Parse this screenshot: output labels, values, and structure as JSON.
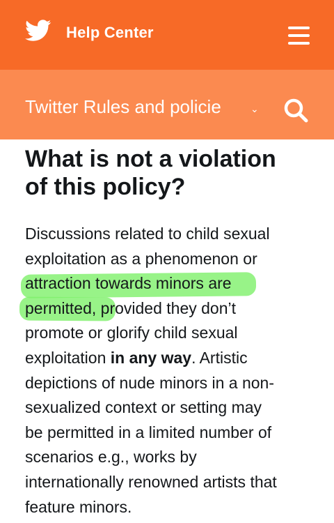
{
  "header": {
    "brand": "Help Center",
    "icons": {
      "logo": "twitter-bird-icon",
      "menu": "hamburger-menu-icon"
    },
    "color": "#f76a27"
  },
  "subnav": {
    "label": "Twitter Rules and policie",
    "chevron": "⌄",
    "icons": {
      "search": "search-icon"
    },
    "color": "#fb8a50"
  },
  "article": {
    "heading_line1": "What is not a violation",
    "heading_line2": "of this policy?",
    "lines": [
      "Discussions related to child sexual",
      "exploitation as a phenomenon or",
      "attraction towards minors are",
      "permitted, provided they don’t",
      "promote or glorify child sexual",
      "exploitation ",
      "in any way",
      ". Artistic",
      "depictions of nude minors in a non-",
      "sexualized context or setting may",
      "be permitted in a limited number of",
      "scenarios e.g., works by",
      "internationally renowned artists that",
      "feature minors."
    ],
    "highlight_color": "#7ef06a"
  }
}
